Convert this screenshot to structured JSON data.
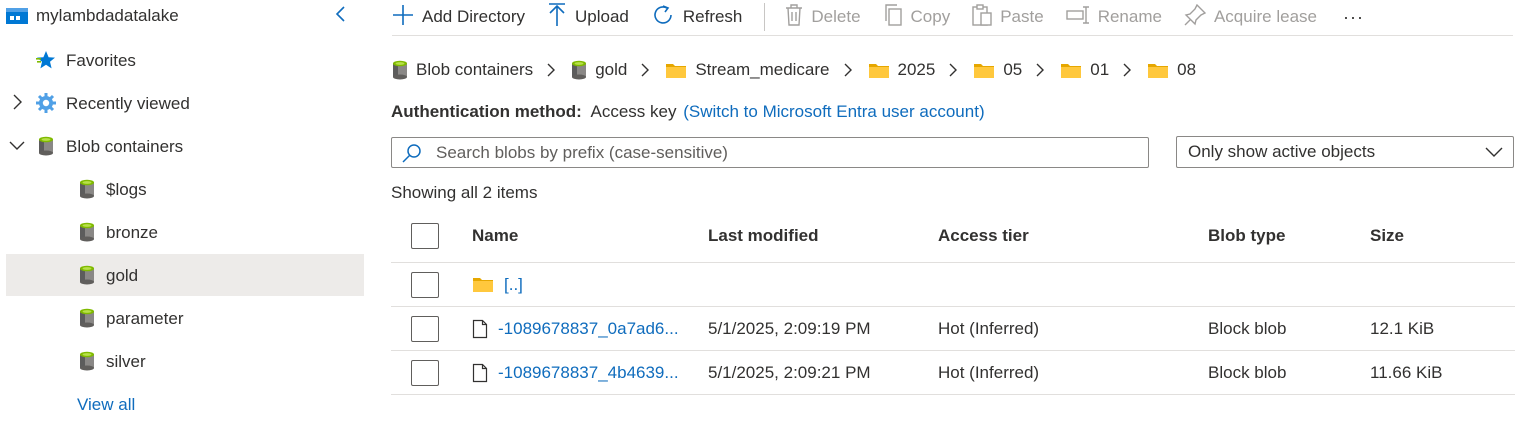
{
  "sidebar": {
    "account": "mylambdadatalake",
    "favorites": "Favorites",
    "recently_viewed": "Recently viewed",
    "blob_containers": "Blob containers",
    "containers": [
      "$logs",
      "bronze",
      "gold",
      "parameter",
      "silver"
    ],
    "selected": "gold",
    "view_all": "View all"
  },
  "toolbar": {
    "add_directory": "Add Directory",
    "upload": "Upload",
    "refresh": "Refresh",
    "delete": "Delete",
    "copy": "Copy",
    "paste": "Paste",
    "rename": "Rename",
    "acquire_lease": "Acquire lease",
    "more": "···"
  },
  "breadcrumb": {
    "root": "Blob containers",
    "container": "gold",
    "folders": [
      "Stream_medicare",
      "2025",
      "05",
      "01",
      "08"
    ]
  },
  "auth": {
    "label": "Authentication method:",
    "value": "Access key",
    "switch_link": "(Switch to Microsoft Entra user account)"
  },
  "search": {
    "placeholder": "Search blobs by prefix (case-sensitive)"
  },
  "filter": {
    "selected": "Only show active objects"
  },
  "count_text": "Showing all 2 items",
  "table": {
    "columns": {
      "name": "Name",
      "last_modified": "Last modified",
      "access_tier": "Access tier",
      "blob_type": "Blob type",
      "size": "Size"
    },
    "parent_row": "[..]",
    "rows": [
      {
        "name": "-1089678837_0a7ad6...",
        "last_modified": "5/1/2025, 2:09:19 PM",
        "access_tier": "Hot (Inferred)",
        "blob_type": "Block blob",
        "size": "12.1 KiB"
      },
      {
        "name": "-1089678837_4b4639...",
        "last_modified": "5/1/2025, 2:09:21 PM",
        "access_tier": "Hot (Inferred)",
        "blob_type": "Block blob",
        "size": "11.66 KiB"
      }
    ]
  },
  "colors": {
    "link": "#0f6cbd",
    "selected_bg": "#edebe9",
    "folder": "#ffb900",
    "disabled": "#a19f9d"
  }
}
